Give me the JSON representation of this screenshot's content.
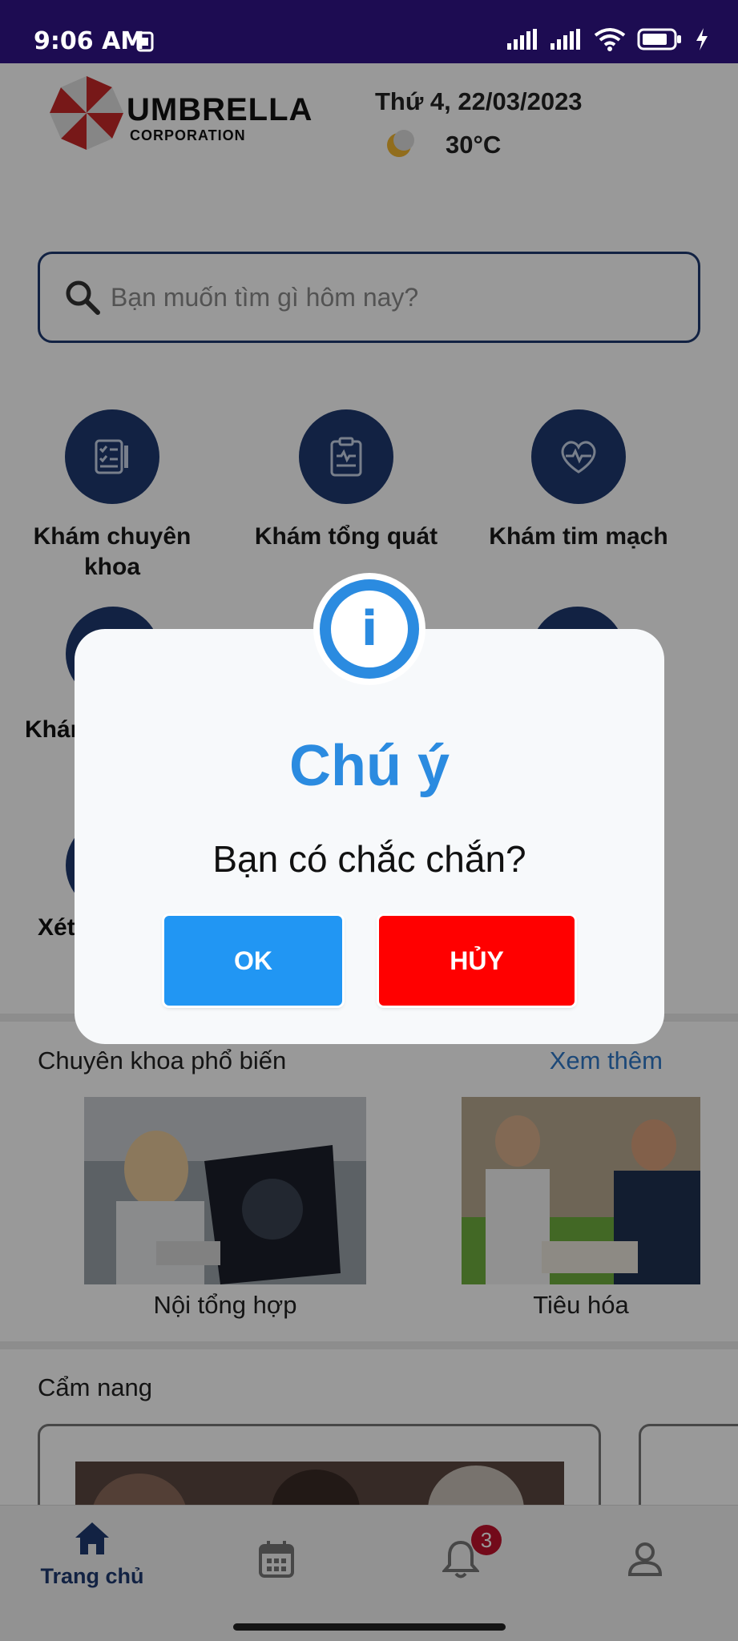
{
  "status_bar": {
    "time": "9:06 AM"
  },
  "header": {
    "logo_text": "UMBRELLA",
    "logo_subtext": "CORPORATION",
    "date": "Thứ 4, 22/03/2023",
    "temperature": "30°C"
  },
  "search": {
    "placeholder": "Bạn muốn tìm gì hôm nay?"
  },
  "services": [
    {
      "label": "Khám chuyên khoa"
    },
    {
      "label": "Khám tổng quát"
    },
    {
      "label": "Khám tim mạch"
    },
    {
      "label": "Khám"
    },
    {
      "label": "Xét"
    }
  ],
  "specialties": {
    "title": "Chuyên khoa phổ biến",
    "see_more": "Xem thêm",
    "items": [
      {
        "label": "Nội tổng hợp"
      },
      {
        "label": "Tiêu hóa"
      }
    ]
  },
  "handbook": {
    "title": "Cẩm nang"
  },
  "bottom_nav": {
    "home_label": "Trang chủ",
    "notification_count": "3"
  },
  "dialog": {
    "title": "Chú ý",
    "message": "Bạn có chắc chắn?",
    "ok_label": "OK",
    "cancel_label": "HỦY",
    "icon_glyph": "i"
  },
  "colors": {
    "primary": "#1e3a70",
    "accent_blue": "#2196f3",
    "danger": "#ff0000",
    "status_bar": "#1d0c52"
  }
}
